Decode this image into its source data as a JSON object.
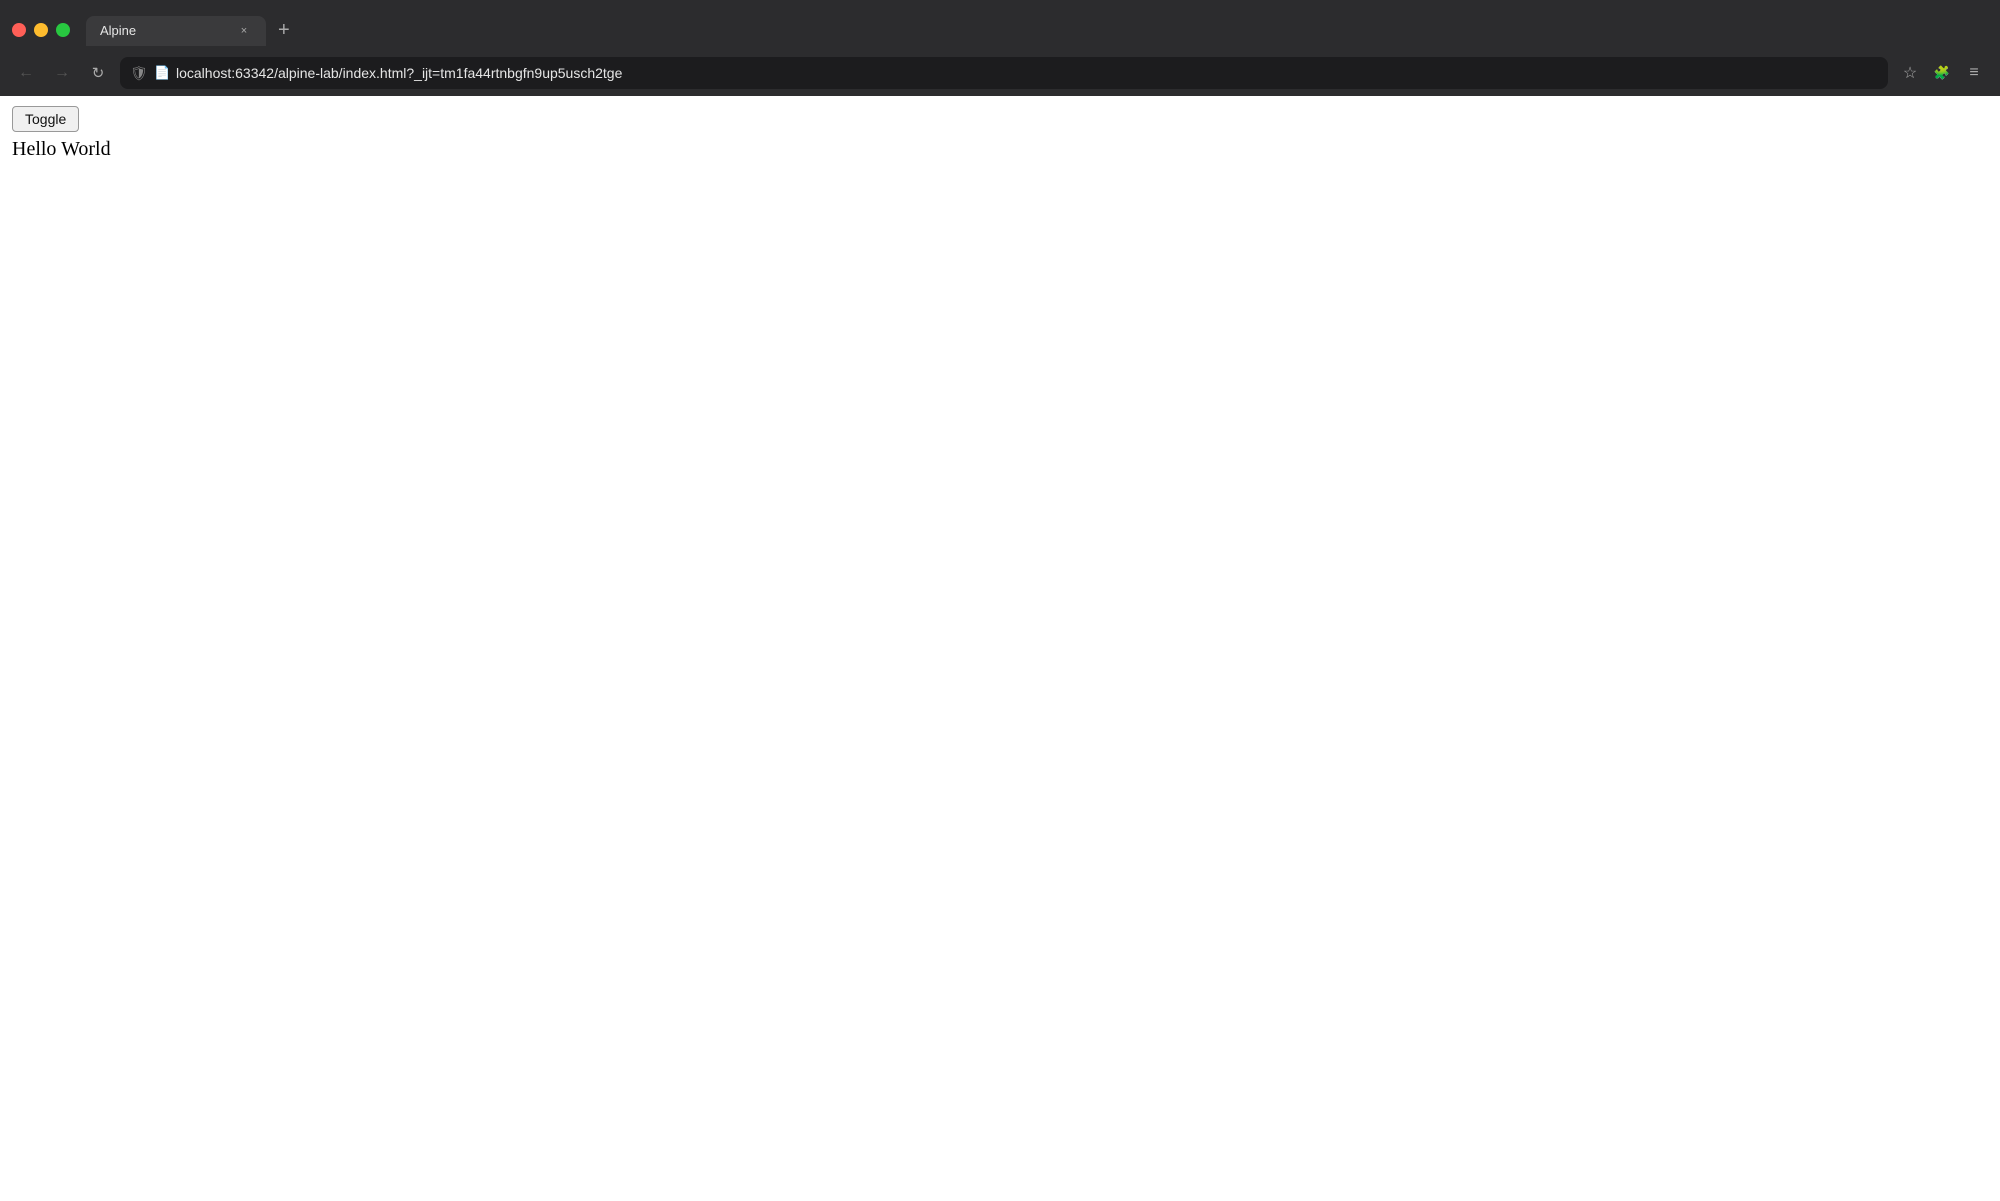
{
  "browser": {
    "tab": {
      "title": "Alpine",
      "close_label": "×"
    },
    "new_tab_label": "+",
    "address_bar": {
      "url": "localhost:63342/alpine-lab/index.html?_ijt=tm1fa44rtnbgfn9up5usch2tge"
    },
    "nav": {
      "back_label": "←",
      "forward_label": "→",
      "reload_label": "↻"
    },
    "toolbar": {
      "bookmark_label": "☆",
      "extensions_label": "🧩",
      "menu_label": "≡"
    }
  },
  "page": {
    "toggle_button_label": "Toggle",
    "hello_world_text": "Hello World"
  }
}
